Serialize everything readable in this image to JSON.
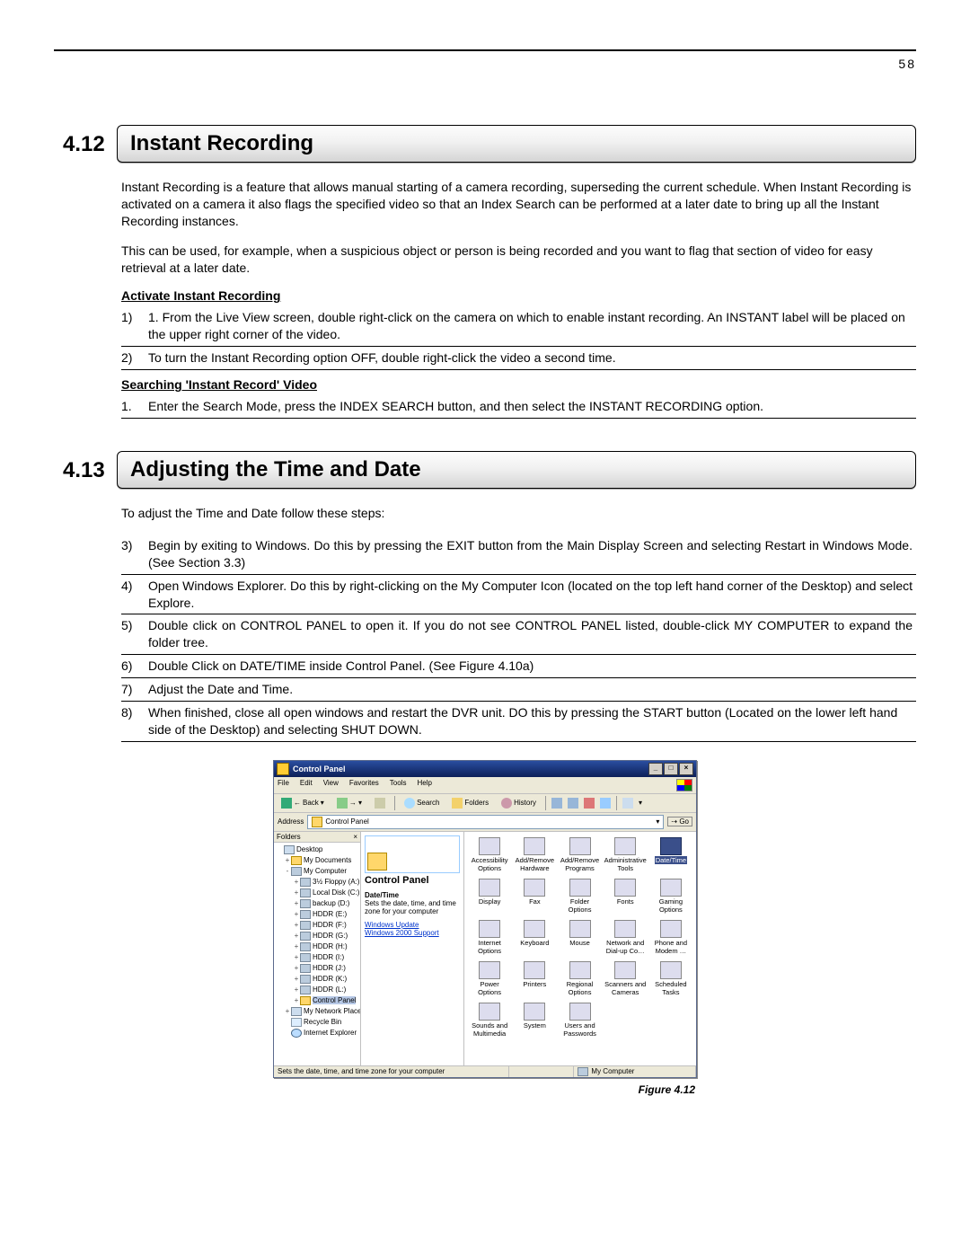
{
  "page_number": "58",
  "sections": [
    {
      "number": "4.12",
      "title": "Instant Recording",
      "paragraphs": [
        "Instant Recording is a feature that allows manual starting of a camera recording, superseding the current schedule. When Instant Recording is activated on a camera it also flags the specified video so that an Index Search can be performed at a later date to bring up all the Instant Recording instances.",
        "This can be used, for example, when a suspicious object or person is being recorded and you want to flag that section of video for easy retrieval at a later date."
      ],
      "groups": [
        {
          "heading": "Activate Instant Recording",
          "steps": [
            {
              "n": "1)",
              "t": "1. From the Live View screen, double right-click on the camera on which to enable instant recording.  An INSTANT label will be placed on the upper right corner of the video."
            },
            {
              "n": "2)",
              "t": "To turn the Instant Recording option OFF, double right-click the video a second time."
            }
          ]
        },
        {
          "heading": "Searching 'Instant Record' Video",
          "steps": [
            {
              "n": "1.",
              "t": "Enter the Search Mode, press the INDEX SEARCH button, and then select the INSTANT RECORDING option."
            }
          ]
        }
      ]
    },
    {
      "number": "4.13",
      "title": "Adjusting the Time and Date",
      "paragraphs": [
        "To adjust the Time and Date follow these steps:"
      ],
      "groups": [
        {
          "heading": "",
          "steps": [
            {
              "n": "3)",
              "t": "Begin by exiting to Windows. Do this by pressing the EXIT button from the Main Display Screen and selecting Restart in Windows Mode. (See Section 3.3)"
            },
            {
              "n": "4)",
              "t": "Open Windows Explorer. Do this by right-clicking on the My Computer Icon (located on the top left hand corner of the Desktop) and select Explore."
            },
            {
              "n": "5)",
              "t": "Double click on CONTROL PANEL to open it. If you do not see CONTROL PANEL listed, double-click MY COMPUTER to expand the folder tree."
            },
            {
              "n": "6)",
              "t": "Double Click on DATE/TIME inside Control Panel. (See Figure 4.10a)"
            },
            {
              "n": "7)",
              "t": "Adjust the Date and Time."
            },
            {
              "n": "8)",
              "t": "When finished, close all open windows and restart the DVR unit. DO this by pressing the START button (Located on the lower left hand side of the Desktop) and selecting SHUT DOWN."
            }
          ]
        }
      ]
    }
  ],
  "figure_caption": "Figure 4.12",
  "control_panel": {
    "title": "Control Panel",
    "menus": [
      "File",
      "Edit",
      "View",
      "Favorites",
      "Tools",
      "Help"
    ],
    "toolbar": {
      "back": "Back",
      "search": "Search",
      "folders": "Folders",
      "history": "History"
    },
    "address_label": "Address",
    "address_value": "Control Panel",
    "go": "Go",
    "folders_header": "Folders",
    "tree": [
      {
        "lvl": 0,
        "icon": "desk",
        "exp": "",
        "label": "Desktop"
      },
      {
        "lvl": 1,
        "icon": "fold",
        "exp": "+",
        "label": "My Documents"
      },
      {
        "lvl": 1,
        "icon": "drive",
        "exp": "-",
        "label": "My Computer"
      },
      {
        "lvl": 2,
        "icon": "drive",
        "exp": "+",
        "label": "3½ Floppy (A:)"
      },
      {
        "lvl": 2,
        "icon": "drive",
        "exp": "+",
        "label": "Local Disk (C:)"
      },
      {
        "lvl": 2,
        "icon": "drive",
        "exp": "+",
        "label": "backup (D:)"
      },
      {
        "lvl": 2,
        "icon": "drive",
        "exp": "+",
        "label": "HDDR (E:)"
      },
      {
        "lvl": 2,
        "icon": "drive",
        "exp": "+",
        "label": "HDDR (F:)"
      },
      {
        "lvl": 2,
        "icon": "drive",
        "exp": "+",
        "label": "HDDR (G:)"
      },
      {
        "lvl": 2,
        "icon": "drive",
        "exp": "+",
        "label": "HDDR (H:)"
      },
      {
        "lvl": 2,
        "icon": "drive",
        "exp": "+",
        "label": "HDDR (I:)"
      },
      {
        "lvl": 2,
        "icon": "drive",
        "exp": "+",
        "label": "HDDR (J:)"
      },
      {
        "lvl": 2,
        "icon": "drive",
        "exp": "+",
        "label": "HDDR (K:)"
      },
      {
        "lvl": 2,
        "icon": "drive",
        "exp": "+",
        "label": "HDDR (L:)"
      },
      {
        "lvl": 2,
        "icon": "fold",
        "exp": "+",
        "label": "Control Panel",
        "sel": true
      },
      {
        "lvl": 1,
        "icon": "net",
        "exp": "+",
        "label": "My Network Places"
      },
      {
        "lvl": 1,
        "icon": "rec",
        "exp": "",
        "label": "Recycle Bin"
      },
      {
        "lvl": 1,
        "icon": "ie",
        "exp": "",
        "label": "Internet Explorer"
      }
    ],
    "info": {
      "title": "Control Panel",
      "item": "Date/Time",
      "desc": "Sets the date, time, and time zone for your computer",
      "links": [
        "Windows Update",
        "Windows 2000 Support"
      ]
    },
    "icons": [
      {
        "c": "Accessibility Options"
      },
      {
        "c": "Add/Remove Hardware"
      },
      {
        "c": "Add/Remove Programs"
      },
      {
        "c": "Administrative Tools"
      },
      {
        "c": "Date/Time",
        "sel": true
      },
      {
        "c": "Display"
      },
      {
        "c": "Fax"
      },
      {
        "c": "Folder Options"
      },
      {
        "c": "Fonts"
      },
      {
        "c": "Gaming Options"
      },
      {
        "c": "Internet Options"
      },
      {
        "c": "Keyboard"
      },
      {
        "c": "Mouse"
      },
      {
        "c": "Network and Dial-up Co…"
      },
      {
        "c": "Phone and Modem …"
      },
      {
        "c": "Power Options"
      },
      {
        "c": "Printers"
      },
      {
        "c": "Regional Options"
      },
      {
        "c": "Scanners and Cameras"
      },
      {
        "c": "Scheduled Tasks"
      },
      {
        "c": "Sounds and Multimedia"
      },
      {
        "c": "System"
      },
      {
        "c": "Users and Passwords"
      }
    ],
    "status_left": "Sets the date, time, and time zone for your computer",
    "status_right": "My Computer"
  }
}
